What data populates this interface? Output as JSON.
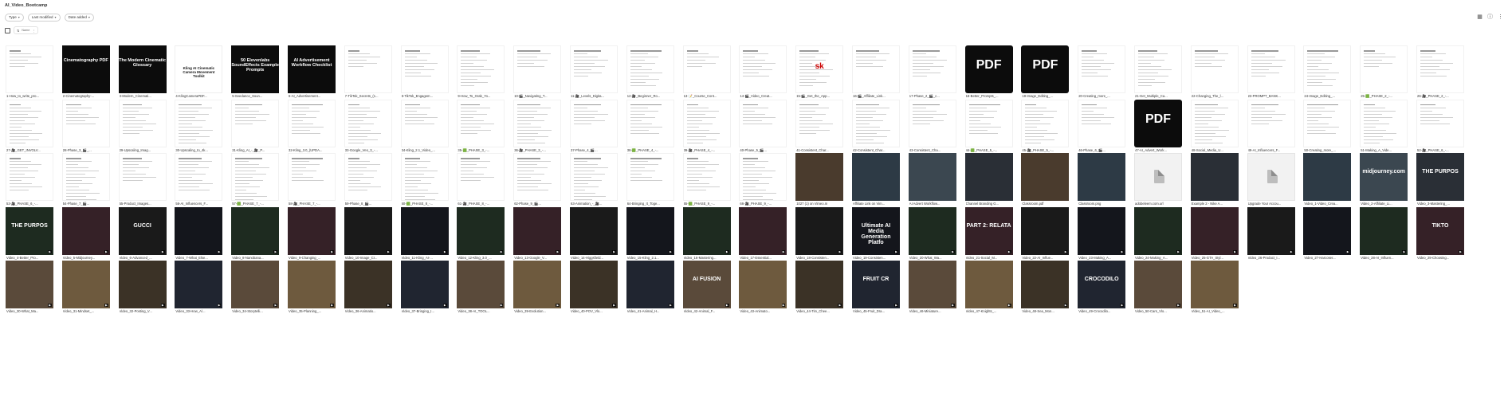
{
  "folder_title": "AI_Video_Bootcamp",
  "filters": [
    "Type",
    "Last modified",
    "Date added"
  ],
  "select_all_placeholder": "Name",
  "icons": {
    "grid_view": "grid-view-icon",
    "info": "info-icon",
    "more": "more-icon"
  },
  "rows": [
    [
      "1-How_to_write_pro...",
      "2-Cinematography-...",
      "3-Modern_Cinemati...",
      "4-KlingCameraPDF...",
      "5-Seedance_Soun...",
      "6-AI_Advertisement...",
      "7-TikTok_Secrets_(1...",
      "8-TikTok_Engagem...",
      "9-How_To_Grab_Yo...",
      "10-🎬_Navigating_T...",
      "11-🎥_Levels_Digita...",
      "12-🎥_Beginner_Ro...",
      "13-📝_Course_Cont...",
      "14-🎬_Video_Creat...",
      "15-🎬_Get_the_App...",
      "16-🎬_Affiliate_Link...",
      "17-Phase_2_🎬_c...",
      "18-Better_Prompts_...",
      "19-Image_Editing_...",
      "20-Creating_more_...",
      "21-Get_Multiple_Ca...",
      "22-Changing_The_l...",
      "23-PROMPT_BANK...",
      "24-Image_Editing_...",
      "25-🟩_PHASE_2_-...",
      "26-🎥_PHASE_2_-..."
    ],
    [
      "27-🎥_GET_INVOLV...",
      "28-Phase_3_🎬_...",
      "29-Upscaling_Imag...",
      "30-Upscaling_to_4k...",
      "31-Kling_AI_-_🎥_P...",
      "32-Kling_3.0_(UPDA...",
      "33-Google_Veo_3_-...",
      "34-Kling_2.1_Video_...",
      "35-🟩_PHASE_3_-...",
      "36-🎥_PHASE_3_-...",
      "37-Phase_4_🎬...",
      "38-🟩_PHASE_4_-...",
      "39-🎥_PHASE_4_-...",
      "40-Phase_5_🎬...",
      "41-Consistent_Char...",
      "42-Consistent_Char...",
      "43-Consistent_Cha...",
      "44-🟩_PHASE_5_-...",
      "45-🎥_PHASE_5_-...",
      "46-Phase_6_🎬...",
      "47-AI_Advert_Work...",
      "48-Social_Media_U...",
      "49-AI_Influencers_F...",
      "50-Creating_more_...",
      "51-Making_A_Vide...",
      "52-🎥_PHASE_6_-..."
    ],
    [
      "53-🎥_PHASE_6_-...",
      "54-Phase_7_🎬...",
      "55-Product_Images...",
      "56-AI_Influencers_F...",
      "57-🟩_PHASE_7_-...",
      "58-🎥_PHASE_7_-...",
      "59-Phase_8_🎬...",
      "60-🟩_PHASE_8_-...",
      "61-🎥_PHASE_8_-...",
      "62-Phase_9_🎬...",
      "63-Animation_-_🎥...",
      "64-Bringing_It_Toge...",
      "65-🟩_PHASE_9_-...",
      "66-🎥_PHASE_9_-...",
      "1027 (1) on Vimeo.m",
      "Affiliate Link on Vim...",
      "AI Advert Workflow...",
      "Channel Branding G...",
      "Classroom.pdf",
      "Classroom.png",
      "adobeleem.com.url",
      "Example 2 - Nike A...",
      "Upgrade Your Accou...",
      "Video_1-Video_Crea...",
      "Video_2-Affiliate_Li...",
      "Video_3-Mastering_..."
    ],
    [
      "Video_4-Better_Pro...",
      "Video_5-Midjourney...",
      "Video_6-Advanced_...",
      "Video_7-What_Else...",
      "Video_8-Nanobana...",
      "Video_9-Changing_...",
      "Video_10-Image_Cr...",
      "Video_11-Kling_AI-...",
      "Video_12-Kling_3.0_...",
      "Video_13-Google_V...",
      "Video_14-Higgsfield...",
      "Video_15-Kling_2.1...",
      "Video_16-Mastering...",
      "Video_17-Essential...",
      "Video_18-Consisten...",
      "Video_19-Consisten...",
      "Video_20-What_Wa...",
      "Video_21-Social_M...",
      "Video_22-AI_Influe...",
      "Video_23-Making_A...",
      "Video_24-Making_A...",
      "Video_25-GTA_Styl...",
      "Video_26-Product_I...",
      "Video_27-Harcoser...",
      "Video_28-AI_Influen...",
      "Video_29-Choosing..."
    ],
    [
      "Video_30-What_Ma...",
      "Video_31-Mindset_...",
      "Video_32-Posting_V...",
      "Video_33-How_A/...",
      "Video_34-Storytelli...",
      "Video_35-Planning_...",
      "Video_36-Animatio...",
      "Video_37-Bringing_I...",
      "Video_38-AI_TOOL...",
      "Video_39-Evolution...",
      "Video_40-POV_Vlo...",
      "Video_41-Animal_H...",
      "Video_42-Animal_F...",
      "Video_43-Animato...",
      "Video_44-Tim_Chee...",
      "Video_45-Fruit_Dra...",
      "Video_46-Miniature...",
      "Video_47-Knights_...",
      "Video_48-Sea_Mon...",
      "Video_49-Crocodilo...",
      "Video_50-Cars_Vlo...",
      "Video_51-AI_Video_..."
    ]
  ],
  "card_texts": {
    "r0c1": "Cinematography PDF",
    "r0c2": "The Modern Cinematic Glossary",
    "r0c3": "Kling AI Cinematic Camera Movement Toolkit",
    "r0c4": "50 Elevenlabs SoundEffects Example Prompts",
    "r0c5": "AI Advertisement Workflow Checklist",
    "r0c14": "sk",
    "r0c17": "PDF",
    "r0c18": "PDF",
    "r1c20": "PDF",
    "r2c24": "midjourney.com",
    "r2c25": "THE PURPOS",
    "r3c0": "THE PURPOS",
    "r3c2": "GUCCI",
    "r3c15": "Ultimate AI Media Generation Platfo",
    "r3c17": "PART 2: RELATA",
    "r3c25": "TIKTO",
    "r4c12": "AI FUSION",
    "r4c15": "FRUIT CR",
    "r4c19": "CROCODILO"
  }
}
